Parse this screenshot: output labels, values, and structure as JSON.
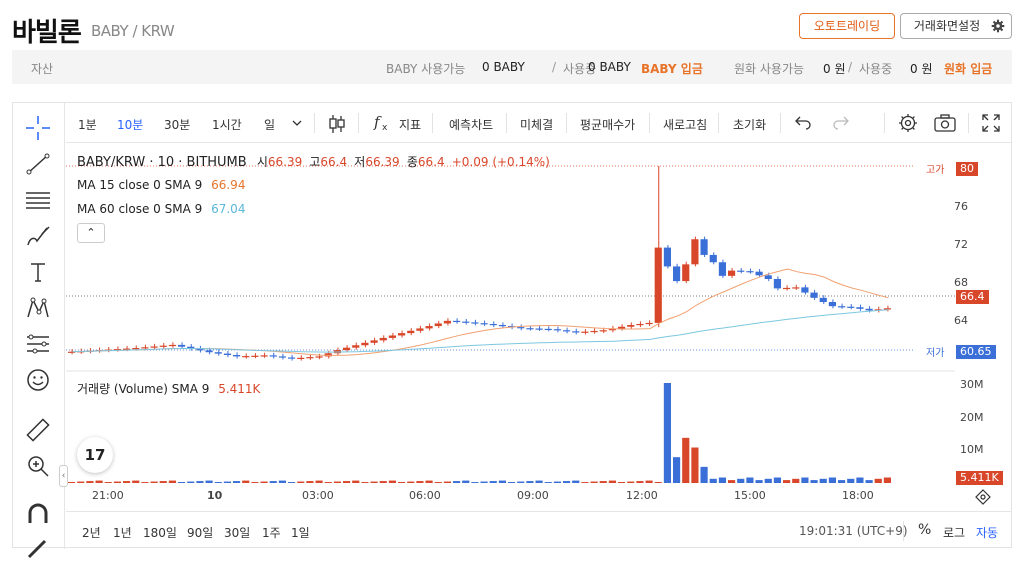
{
  "header": {
    "coin_name": "바빌론",
    "pair": "BABY / KRW",
    "auto_trading": "오토트레이딩",
    "screen_settings": "거래화면설정"
  },
  "assets": {
    "label": "자산",
    "coin_avail_label": "BABY 사용가능",
    "coin_avail_value": "0 BABY",
    "sep": "/",
    "in_use_label": "사용중",
    "coin_in_use_value": "0 BABY",
    "coin_deposit": "BABY 입금",
    "krw_avail_label": "원화 사용가능",
    "krw_avail_value": "0 원",
    "krw_in_use_value": "0 원",
    "krw_deposit": "원화 입금"
  },
  "toolbar": {
    "intervals": [
      "1분",
      "10분",
      "30분",
      "1시간",
      "일"
    ],
    "indicators": "지표",
    "forecast": "예측차트",
    "unfilled": "미체결",
    "avg_price": "평균매수가",
    "refresh": "새로고침",
    "reset": "초기화"
  },
  "legend": {
    "symbol": "BABY/KRW · 10 · BITHUMB",
    "o_label": "시",
    "o": "66.39",
    "h_label": "고",
    "h": "66.4",
    "l_label": "저",
    "l": "66.39",
    "c_label": "종",
    "c": "66.4",
    "chg": "+0.09 (+0.14%)",
    "ma15": "MA 15 close 0 SMA 9",
    "ma15_val": "66.94",
    "ma60": "MA 60 close 0 SMA 9",
    "ma60_val": "67.04",
    "volume": "거래량 (Volume)  SMA 9",
    "volume_val": "5.411K"
  },
  "price_axis": [
    "76",
    "72",
    "68",
    "64"
  ],
  "volume_axis": [
    "30M",
    "20M",
    "10M"
  ],
  "tags": {
    "high": "80",
    "high_label": "고가",
    "current": "66.4",
    "low": "60.65",
    "low_label": "저가",
    "vol": "5.411K"
  },
  "time_axis": [
    "21:00",
    "10",
    "03:00",
    "06:00",
    "09:00",
    "12:00",
    "15:00",
    "18:00"
  ],
  "ranges": [
    "2년",
    "1년",
    "180일",
    "90일",
    "30일",
    "1주",
    "1일"
  ],
  "status": {
    "time": "19:01:31 (UTC+9)",
    "percent": "%",
    "log": "로그",
    "auto": "자동"
  },
  "colors": {
    "up": "#d9472b",
    "down": "#3a6fd8",
    "ma15": "#f0a070",
    "ma60": "#7cc7e0",
    "accent": "#2962ff"
  },
  "chart_data": {
    "type": "candlestick",
    "symbol": "BABY/KRW",
    "interval": "10",
    "exchange": "BITHUMB",
    "ylim": [
      60,
      81
    ],
    "high": 80,
    "low": 60.65,
    "current": 66.4,
    "volume_ylim": [
      0,
      32
    ],
    "volume_unit": "M",
    "price_path": [
      [
        0,
        62.2
      ],
      [
        8,
        62.6
      ],
      [
        12,
        62.9
      ],
      [
        16,
        62.2
      ],
      [
        19,
        61.8
      ],
      [
        22,
        61.9
      ],
      [
        25,
        61.6
      ],
      [
        28,
        61.8
      ],
      [
        30,
        62.4
      ],
      [
        33,
        63.1
      ],
      [
        36,
        63.8
      ],
      [
        40,
        64.7
      ],
      [
        42,
        65.2
      ],
      [
        46,
        64.9
      ],
      [
        50,
        64.5
      ],
      [
        53,
        64.4
      ],
      [
        56,
        64.1
      ],
      [
        59,
        64.3
      ],
      [
        62,
        64.8
      ],
      [
        64,
        65.0
      ],
      [
        65,
        72.2
      ],
      [
        66,
        70.4
      ],
      [
        67,
        69.0
      ],
      [
        68,
        70.6
      ],
      [
        69,
        73.0
      ],
      [
        70,
        71.5
      ],
      [
        71,
        70.8
      ],
      [
        72,
        69.5
      ],
      [
        73,
        70.0
      ],
      [
        75,
        69.9
      ],
      [
        77,
        69.2
      ],
      [
        78,
        68.3
      ],
      [
        80,
        68.4
      ],
      [
        82,
        67.4
      ],
      [
        84,
        66.6
      ],
      [
        86,
        66.5
      ],
      [
        88,
        66.2
      ],
      [
        90,
        66.4
      ]
    ],
    "volume_peaks": [
      [
        65,
        31
      ],
      [
        66,
        8
      ],
      [
        67,
        14
      ],
      [
        68,
        11
      ],
      [
        69,
        5
      ]
    ]
  }
}
